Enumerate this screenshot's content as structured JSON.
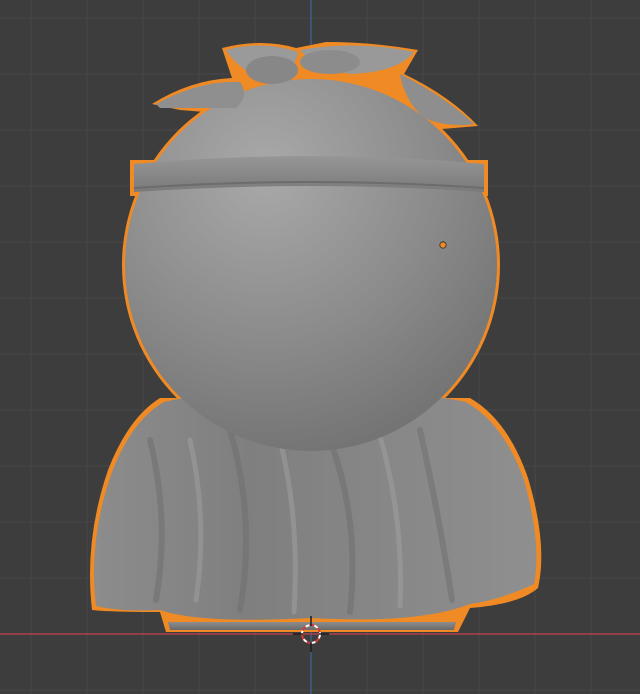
{
  "viewport": {
    "mode": "object-mode-front-orthographic",
    "background_color": "#3d3d3d",
    "grid_color": "#474747",
    "x_axis_color": "#c4414f",
    "z_axis_color": "#3a6bb0",
    "selection_outline_color": "#f08a24",
    "mesh_color": "#8a8a8a"
  },
  "scene": {
    "selected_object": "character-mesh",
    "cursor": "3d-cursor-icon",
    "origin": "object-origin-dot"
  }
}
